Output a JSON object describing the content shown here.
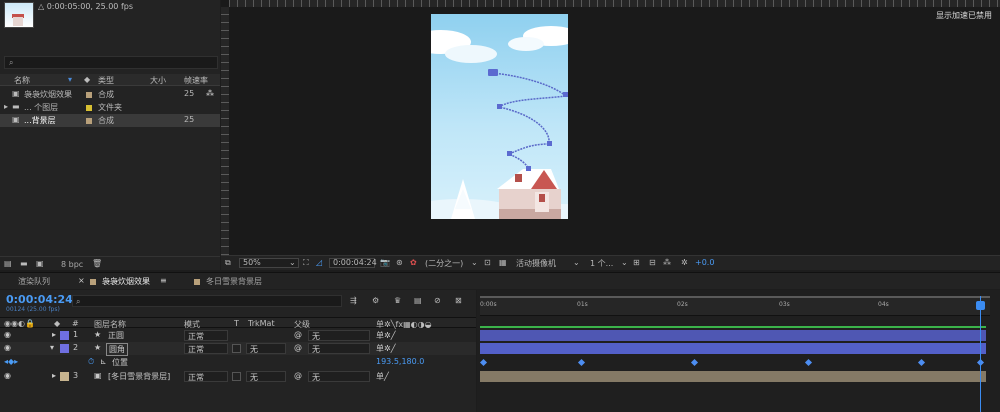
{
  "project": {
    "comp_info": "△ 0:00:05:00, 25.00 fps",
    "columns": {
      "name": "名称",
      "type": "类型",
      "size": "大小",
      "framerate": "帧速率"
    },
    "items": [
      {
        "name": "袅袅炊烟效果",
        "type": "合成",
        "framerate": "25",
        "color": "#b8a07a"
      },
      {
        "name": "... 个图层",
        "type": "文件夹",
        "framerate": "",
        "color": "#d8c032"
      },
      {
        "name": "...背景层",
        "type": "合成",
        "framerate": "25",
        "color": "#b8a07a"
      }
    ],
    "bpc": "8 bpc"
  },
  "viewer": {
    "gpu_text": "显示加速已禁用",
    "zoom": "50%",
    "timecode": "0:00:04:24",
    "resolution": "(二分之一)",
    "camera": "活动摄像机",
    "views": "1 个...",
    "exposure": "+0.0"
  },
  "timeline": {
    "tabs": [
      "渲染队列",
      "袅袅炊烟效果",
      "冬日雪景背景层"
    ],
    "current_time": "0:00:04:24",
    "fps_sub": "00124 (25.00 fps)",
    "headers": {
      "num": "#",
      "name": "图层名称",
      "mode": "模式",
      "t": "T",
      "trkmat": "TrkMat",
      "parent": "父级"
    },
    "ruler": [
      "0:00s",
      "01s",
      "02s",
      "03s",
      "04s"
    ],
    "layers": [
      {
        "num": "1",
        "name": "正圆",
        "mode": "正常",
        "trkmat": "",
        "parent": "无",
        "color": "#6f6fe0"
      },
      {
        "num": "2",
        "name": "圆角",
        "mode": "正常",
        "trkmat": "无",
        "parent": "无",
        "color": "#6f6fe0"
      },
      {
        "num": "3",
        "name": "[冬日雪景背景层]",
        "mode": "正常",
        "trkmat": "无",
        "parent": "无",
        "color": "#c7b48f"
      }
    ],
    "property": {
      "name": "位置",
      "value": "193.5,180.0"
    }
  }
}
